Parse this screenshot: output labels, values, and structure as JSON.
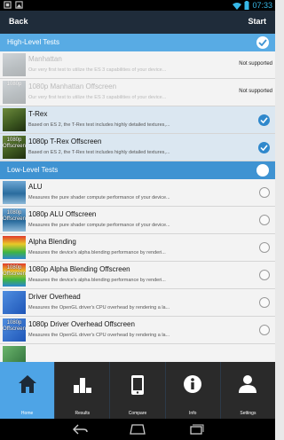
{
  "status_bar": {
    "time": "07:33"
  },
  "top_bar": {
    "back_label": "Back",
    "start_label": "Start"
  },
  "sections": {
    "high": {
      "title": "High-Level Tests"
    },
    "low": {
      "title": "Low-Level Tests"
    }
  },
  "high_tests": [
    {
      "title": "Manhattan",
      "desc": "Our very first test to utilize the ES 3 capabilities of your device...",
      "status": "Not supported",
      "thumb_label": ""
    },
    {
      "title": "1080p Manhattan Offscreen",
      "desc": "Our very first test to utilize the ES 3 capabilities of your device...",
      "status": "Not supported",
      "thumb_label": "1080p"
    },
    {
      "title": "T-Rex",
      "desc": "Based on ES 2, the T-Rex test includes highly detailed textures,...",
      "status": "",
      "thumb_label": ""
    },
    {
      "title": "1080p T-Rex Offscreen",
      "desc": "Based on ES 2, the T-Rex test includes highly detailed textures,...",
      "status": "",
      "thumb_label": "1080p Offscreen"
    }
  ],
  "low_tests": [
    {
      "title": "ALU",
      "desc": "Measures the pure shader compute performance of your device...",
      "thumb_label": ""
    },
    {
      "title": "1080p ALU Offscreen",
      "desc": "Measures the pure shader compute performance of your device...",
      "thumb_label": "1080p Offscreen"
    },
    {
      "title": "Alpha Blending",
      "desc": "Measures the device's alpha blending performance by renderi...",
      "thumb_label": ""
    },
    {
      "title": "1080p Alpha Blending Offscreen",
      "desc": "Measures the device's alpha blending performance by renderi...",
      "thumb_label": "1080p Offscreen"
    },
    {
      "title": "Driver Overhead",
      "desc": "Measures the OpenGL driver's CPU overhead by rendering a la...",
      "thumb_label": ""
    },
    {
      "title": "1080p Driver Overhead Offscreen",
      "desc": "Measures the OpenGL driver's CPU overhead by rendering a la...",
      "thumb_label": "1080p Offscreen"
    }
  ],
  "bottom_nav": [
    {
      "label": "Home",
      "icon": "home-icon"
    },
    {
      "label": "Results",
      "icon": "bar-chart-icon"
    },
    {
      "label": "Compare",
      "icon": "phone-icon"
    },
    {
      "label": "Info",
      "icon": "info-icon"
    },
    {
      "label": "Settings",
      "icon": "person-icon"
    }
  ],
  "colors": {
    "top_bar": "#1f2c3a",
    "section_header": "#58abe4",
    "accent": "#2f88cc",
    "nav_active": "#4ea4e6"
  }
}
